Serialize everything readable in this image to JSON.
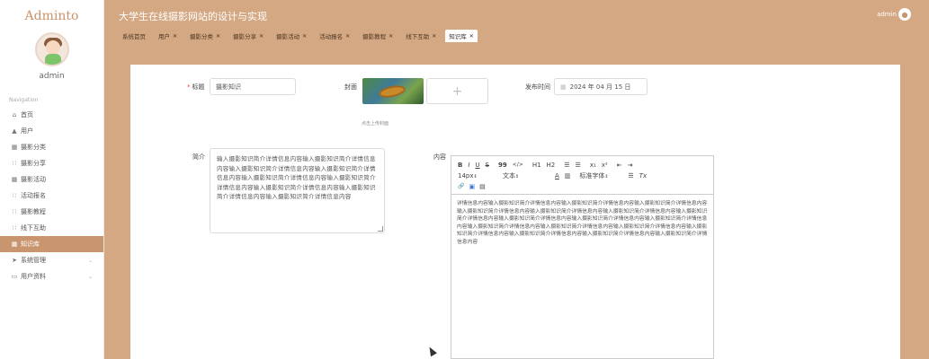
{
  "sidebar": {
    "logo": "Adminto",
    "username": "admin",
    "nav_label": "Navigation",
    "items": [
      {
        "label": "首页",
        "icon": "home-icon",
        "glyph": "⌂"
      },
      {
        "label": "用户",
        "icon": "user-icon",
        "glyph": "▲"
      },
      {
        "label": "摄影分类",
        "icon": "grid-icon",
        "glyph": "▦"
      },
      {
        "label": "摄影分享",
        "icon": "grid-icon",
        "glyph": "∷"
      },
      {
        "label": "摄影活动",
        "icon": "grid-icon",
        "glyph": "▦"
      },
      {
        "label": "活动报名",
        "icon": "grid-icon",
        "glyph": "∷"
      },
      {
        "label": "摄影教程",
        "icon": "grid-icon",
        "glyph": "∷"
      },
      {
        "label": "线下互助",
        "icon": "grid-icon",
        "glyph": "∷"
      },
      {
        "label": "知识库",
        "icon": "grid-icon",
        "glyph": "▦",
        "active": true
      },
      {
        "label": "系统管理",
        "icon": "send-icon",
        "glyph": "➤",
        "chevron": "⌄"
      },
      {
        "label": "用户资料",
        "icon": "profile-icon",
        "glyph": "▭",
        "chevron": "⌄"
      }
    ]
  },
  "header": {
    "title": "大学生在线摄影网站的设计与实现",
    "user": "admin"
  },
  "tabs": [
    {
      "label": "系统首页",
      "closable": false
    },
    {
      "label": "用户",
      "closable": true
    },
    {
      "label": "摄影分类",
      "closable": true
    },
    {
      "label": "摄影分享",
      "closable": true
    },
    {
      "label": "摄影活动",
      "closable": true
    },
    {
      "label": "活动报名",
      "closable": true
    },
    {
      "label": "摄影教程",
      "closable": true
    },
    {
      "label": "线下互助",
      "closable": true
    },
    {
      "label": "知识库",
      "closable": true,
      "active": true
    }
  ],
  "form": {
    "title_label": "标题",
    "title_required_mark": "*",
    "title_value": "摄影知识",
    "cover_label": "封面",
    "upload_plus": "+",
    "upload_hint": "点击上传封面",
    "date_label": "发布时间",
    "date_value": "2024 年 04 月 15 日",
    "intro_label": "简介",
    "intro_value": "输入摄影知识简介详情信息内容输入摄影知识简介详情信息内容输入摄影知识简介详情信息内容输入摄影知识简介详情信息内容输入摄影知识简介详情信息内容输入摄影知识简介详情信息内容输入摄影知识简介详情信息内容输入摄影知识简介详情信息内容输入摄影知识简介详情信息内容",
    "content_label": "内容",
    "content_value": "详情信息内容输入摄影知识简介详情信息内容输入摄影知识简介详情信息内容输入摄影知识简介详情信息内容输入摄影知识简介详情信息内容输入摄影知识简介详情信息内容输入摄影知识简介详情信息内容输入摄影知识简介详情信息内容输入摄影知识简介详情信息内容输入摄影知识简介详情信息内容输入摄影知识简介详情信息内容输入摄影知识简介详情信息内容输入摄影知识简介详情信息内容输入摄影知识简介详情信息内容输入摄影知识简介详情信息内容输入摄影知识简介详情信息内容输入摄影知识简介详情信息内容输入摄影知识简介详情信息内容"
  },
  "editor_toolbar": {
    "bold": "B",
    "italic": "I",
    "underline": "U",
    "strike": "S",
    "quote": "99",
    "code": "</>",
    "h1": "H1",
    "h2": "H2",
    "ordered": "☰",
    "bullet": "☰",
    "sub": "x₁",
    "sup": "x²",
    "indent_left": "⇤",
    "indent_right": "⇥",
    "size_value": "14px",
    "paragraph_value": "文本",
    "color": "A",
    "background": "▥",
    "font_value": "标准字体",
    "align": "☰",
    "clear": "Tx",
    "link": "🔗",
    "image": "▣",
    "video": "▤"
  },
  "colors": {
    "accent": "#c8956e",
    "header_bg": "#d4a882"
  }
}
